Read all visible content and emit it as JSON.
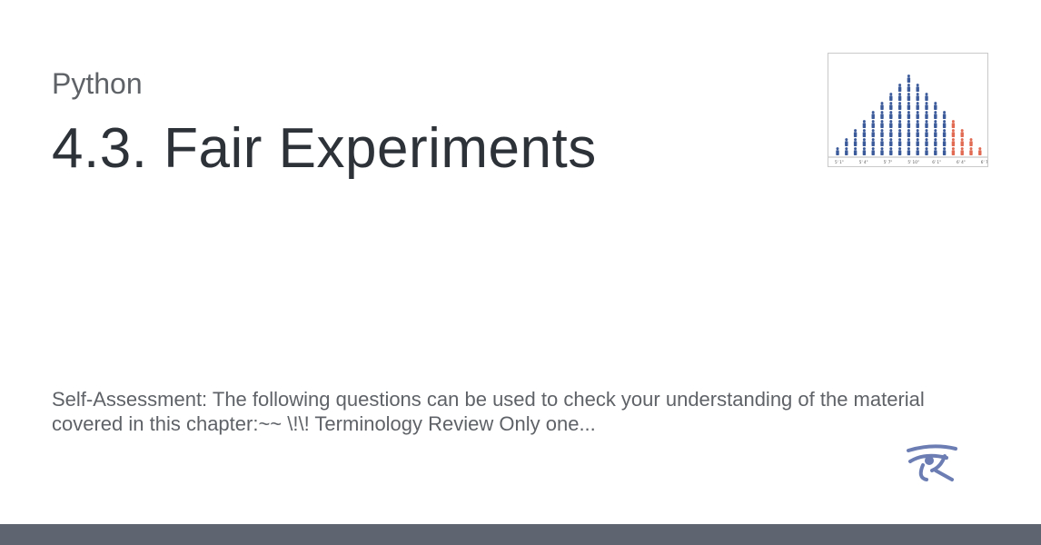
{
  "card": {
    "site_name": "Python",
    "title": "4.3. Fair Experiments",
    "description": "Self-Assessment: The following questions can be used to check your understanding of the material covered in this chapter:~~ \\!\\! Terminology Review Only one..."
  },
  "thumbnail": {
    "tick_labels": [
      "5' 1\"",
      "5' 4\"",
      "5' 7\"",
      "5' 10\"",
      "6' 1\"",
      "6' 4\"",
      "6' 7\""
    ],
    "column_counts": [
      1,
      2,
      3,
      4,
      5,
      6,
      7,
      8,
      9,
      8,
      7,
      6,
      5,
      4,
      3,
      2,
      1
    ],
    "highlight_from_column": 13,
    "colors": {
      "base": "#3b5a9a",
      "highlight": "#e06a52"
    }
  },
  "logo": {
    "icon": "eye-of-horus-icon",
    "color": "#6b7db3"
  },
  "colors": {
    "title": "#2d3239",
    "muted": "#5f6368",
    "footer": "#5e6470",
    "background": "#ffffff"
  }
}
